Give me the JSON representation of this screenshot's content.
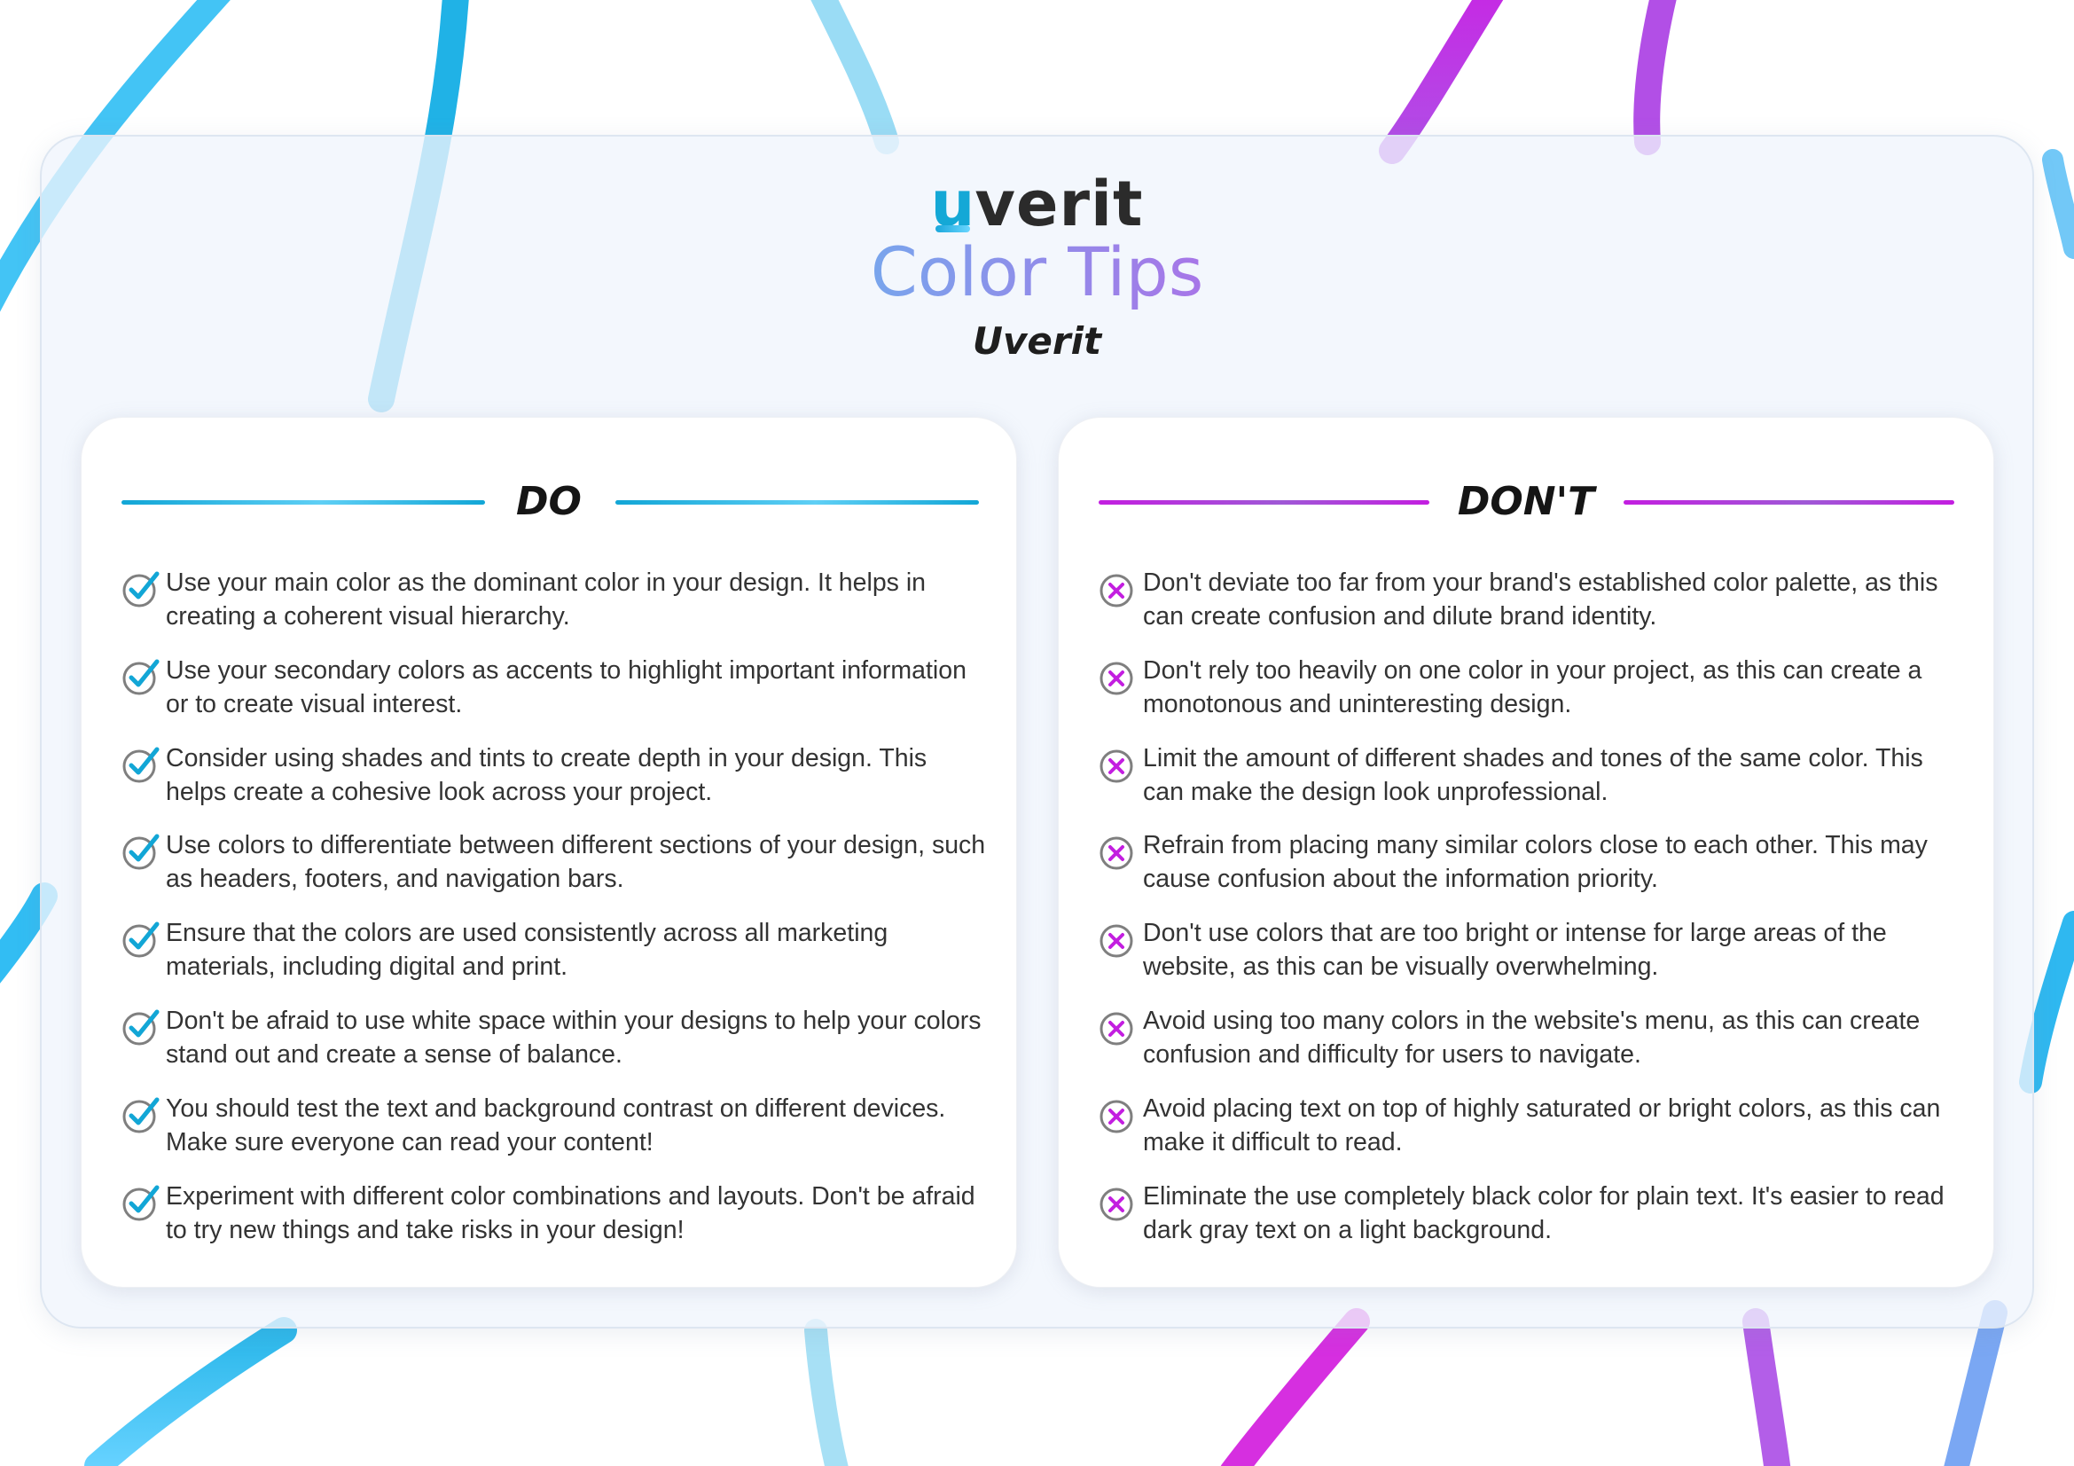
{
  "brand": {
    "logo_u": "u",
    "logo_rest": "verit",
    "title": "Color Tips",
    "subtitle": "Uverit"
  },
  "colors": {
    "do_accent": "#12a6d6",
    "dont_accent": "#c31ee0",
    "text": "#333333"
  },
  "icons": {
    "do": "check-circle-icon",
    "dont": "x-circle-icon"
  },
  "do": {
    "title": "DO",
    "items": [
      "Use your main color as the dominant color in your design. It helps in creating a coherent visual hierarchy.",
      "Use your secondary colors as accents to highlight important information or to create visual interest.",
      "Consider using shades and tints to create depth in your design. This helps create a cohesive look across your project.",
      "Use colors to differentiate between different sections of your design, such as headers, footers, and navigation bars.",
      "Ensure that the colors are used consistently across all marketing materials, including digital and print.",
      "Don't be afraid to use white space within your designs to help your colors stand out and create a sense of balance.",
      "You should test the text and background contrast on different devices. Make sure everyone can read your content!",
      "Experiment with different color combinations and layouts. Don't be afraid to try new things and take risks in your design!"
    ]
  },
  "dont": {
    "title": "DON'T",
    "items": [
      "Don't deviate too far from your brand's established color palette, as this can create confusion and dilute brand identity.",
      "Don't rely too heavily on one color in your project, as this can create a monotonous and uninteresting design.",
      "Limit the amount of different shades and tones of the same color. This can make the design look unprofessional.",
      "Refrain from placing many similar colors close to each other. This may cause confusion about the information priority.",
      "Don't use colors that are too bright or intense for large areas of the website, as this can be visually overwhelming.",
      "Avoid using too many colors in the website's menu, as this can create confusion and difficulty for users to navigate.",
      "Avoid placing text on top of highly saturated or bright colors, as this can make it difficult to read.",
      "Eliminate the use completely black color for plain text. It's easier to read dark gray text on a light background."
    ]
  }
}
